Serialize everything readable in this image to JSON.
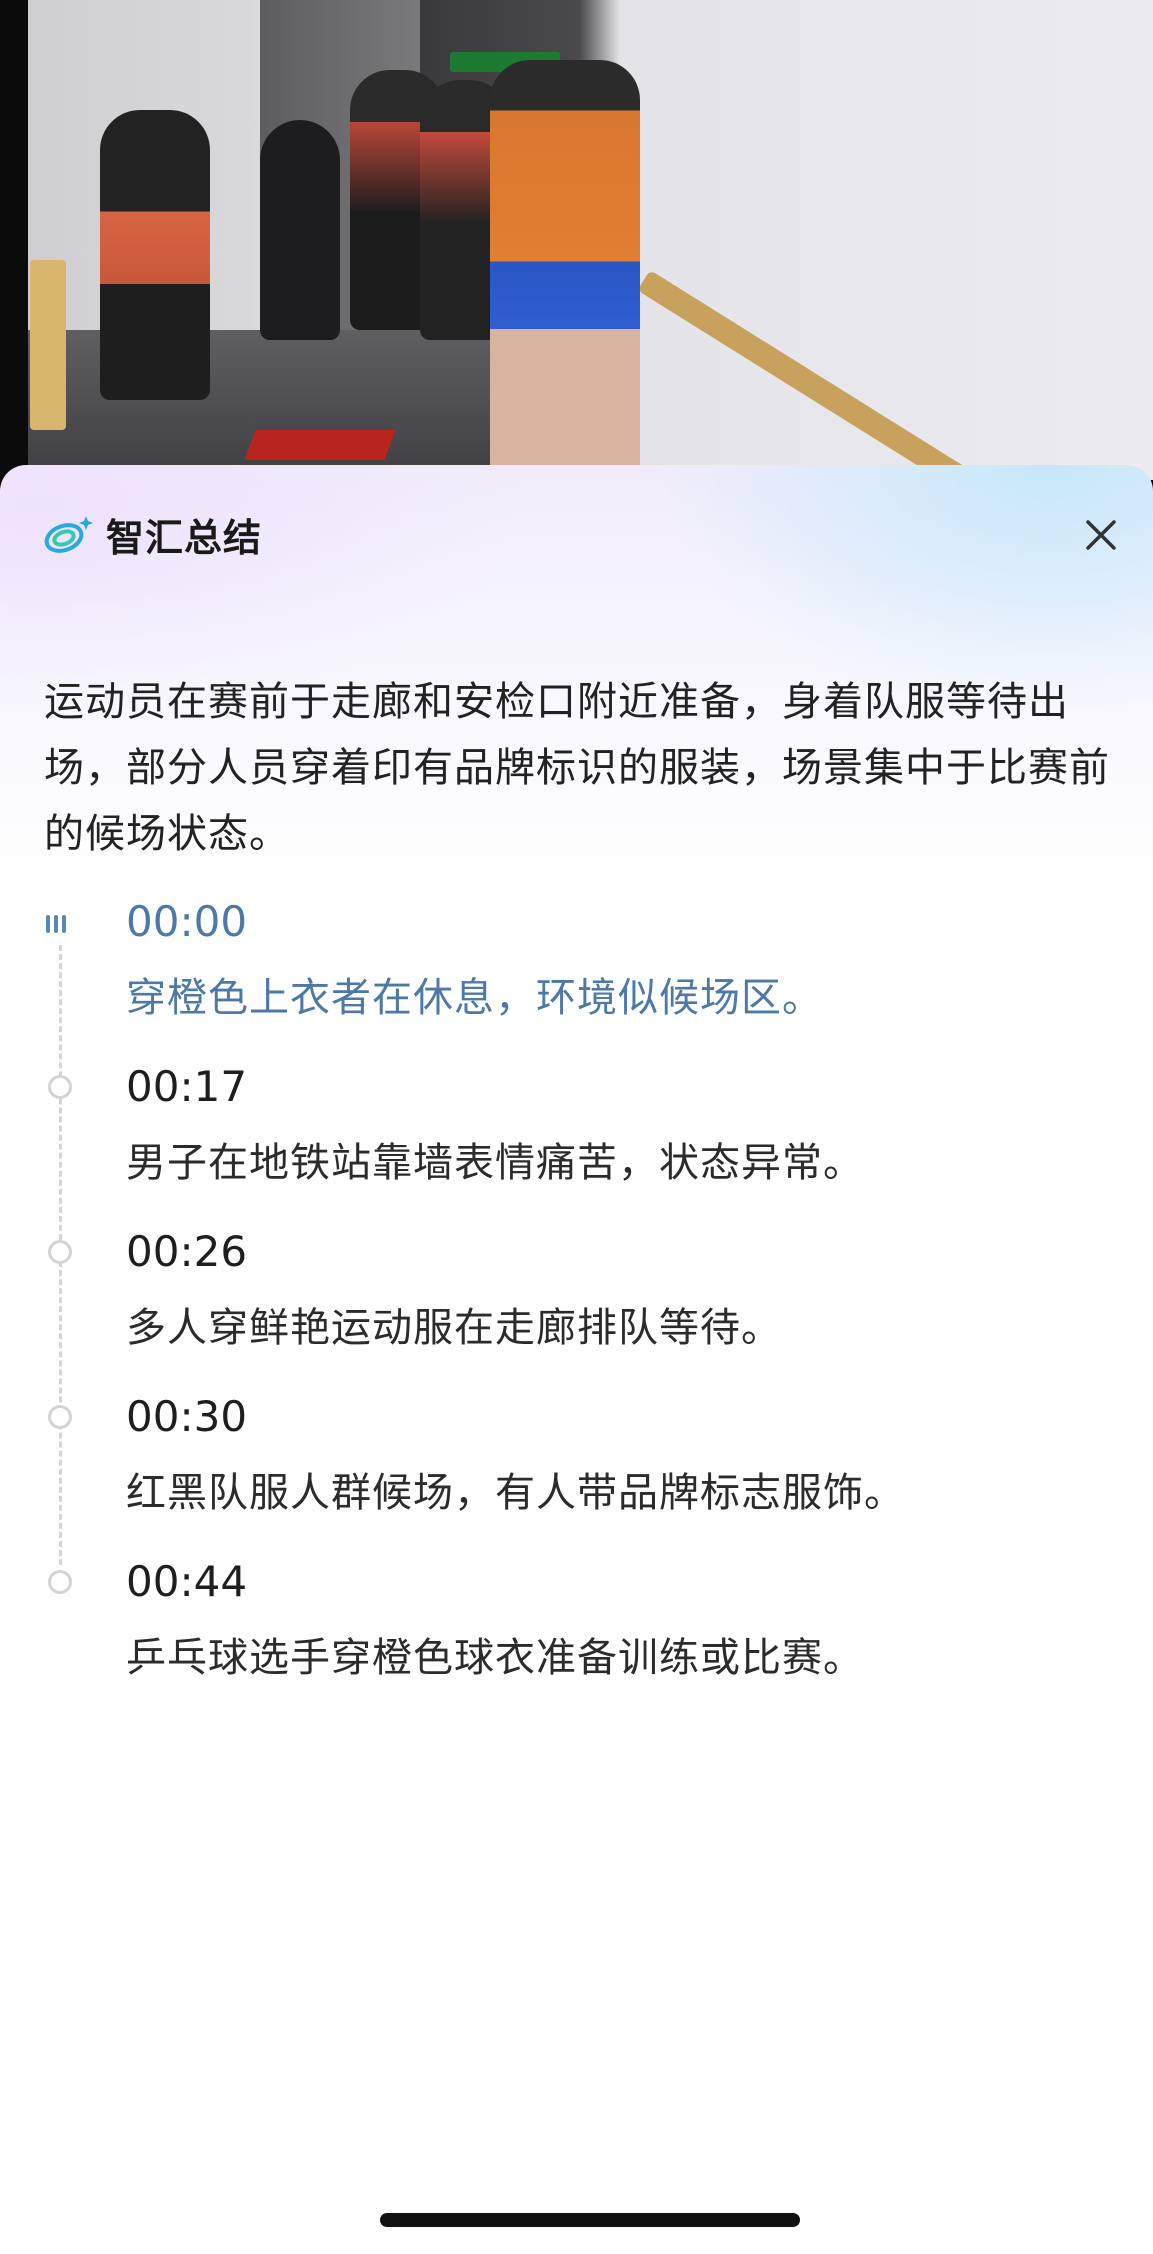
{
  "panel": {
    "title": "智汇总结",
    "summary": "运动员在赛前于走廊和安检口附近准备，身着队服等待出场，部分人员穿着印有品牌标识的服装，场景集中于比赛前的候场状态。"
  },
  "timeline": [
    {
      "time": "00:00",
      "text": "穿橙色上衣者在休息，环境似候场区。",
      "active": true
    },
    {
      "time": "00:17",
      "text": "男子在地铁站靠墙表情痛苦，状态异常。",
      "active": false
    },
    {
      "time": "00:26",
      "text": "多人穿鲜艳运动服在走廊排队等待。",
      "active": false
    },
    {
      "time": "00:30",
      "text": "红黑队服人群候场，有人带品牌标志服饰。",
      "active": false
    },
    {
      "time": "00:44",
      "text": "乒乓球选手穿橙色球衣准备训练或比赛。",
      "active": false
    }
  ],
  "icons": {
    "logo": "swirl-planet-logo-icon",
    "close": "close-icon",
    "active_marker": "playing-bars-icon",
    "inactive_marker": "circle-dot-icon"
  },
  "colors": {
    "active_text": "#4d79a6",
    "text": "#222222",
    "logo_blue": "#2aa7e0",
    "logo_teal": "#35c9b5"
  }
}
